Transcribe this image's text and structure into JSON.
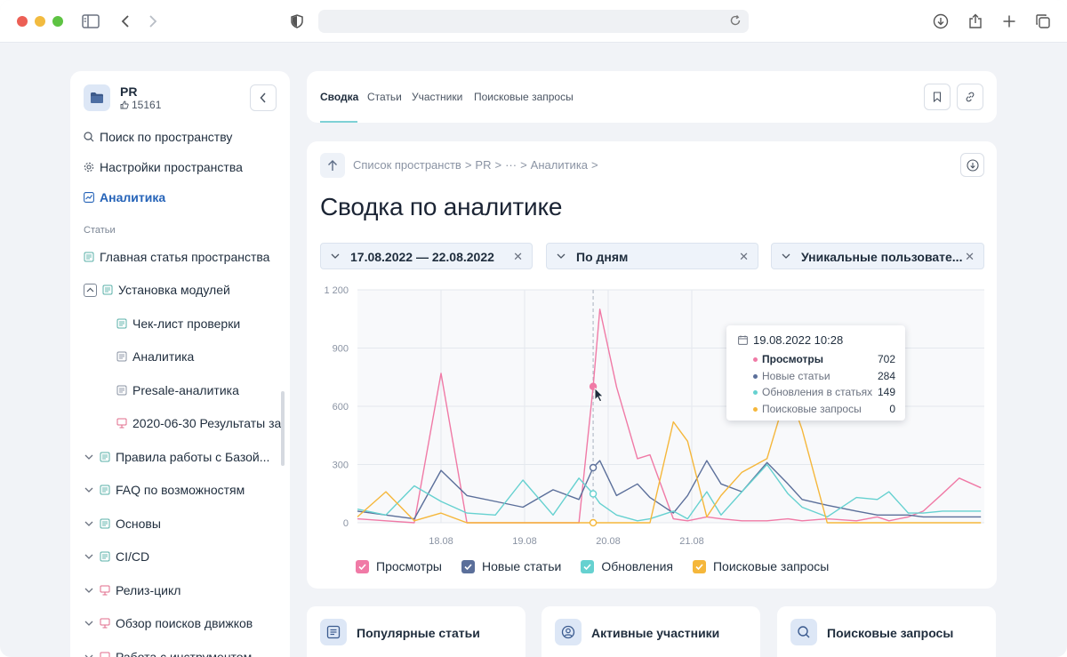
{
  "sidebar": {
    "space_name": "PR",
    "space_likes": "15161",
    "links": [
      {
        "label": "Поиск по пространству"
      },
      {
        "label": "Настройки пространства"
      },
      {
        "label": "Аналитика"
      }
    ],
    "section_label": "Статьи",
    "tree": [
      {
        "label": "Главная статья пространства"
      },
      {
        "label": "Установка модулей"
      },
      {
        "label": "Чек-лист проверки"
      },
      {
        "label": "Аналитика"
      },
      {
        "label": "Presale-аналитика"
      },
      {
        "label": "2020-06-30 Результаты за"
      },
      {
        "label": "Правила работы с Базой..."
      },
      {
        "label": "FAQ по возможностям"
      },
      {
        "label": "Основы"
      },
      {
        "label": "CI/CD"
      },
      {
        "label": "Релиз-цикл"
      },
      {
        "label": "Обзор поисков движков"
      },
      {
        "label": "Работа с инструментом"
      }
    ]
  },
  "tabs": [
    {
      "label": "Сводка"
    },
    {
      "label": "Статьи"
    },
    {
      "label": "Участники"
    },
    {
      "label": "Поисковые запросы"
    }
  ],
  "breadcrumb": {
    "items": [
      "Список пространств",
      "PR",
      "···",
      "Аналитика"
    ],
    "separator": ">"
  },
  "page_title": "Сводка по аналитике",
  "filters": {
    "date_range": "17.08.2022 — 22.08.2022",
    "granularity": "По дням",
    "metric": "Уникальные пользовате..."
  },
  "tooltip": {
    "date": "19.08.2022 10:28",
    "rows": [
      {
        "label": "Просмотры",
        "value": "702",
        "color": "#f07aa6"
      },
      {
        "label": "Новые статьи",
        "value": "284",
        "color": "#5b6f9a"
      },
      {
        "label": "Обновления в статьях",
        "value": "149",
        "color": "#66d1d0"
      },
      {
        "label": "Поисковые запросы",
        "value": "0",
        "color": "#f5b73b"
      }
    ]
  },
  "chart_data": {
    "type": "line",
    "ylim": [
      0,
      1200
    ],
    "y_ticks": [
      "0",
      "300",
      "600",
      "900",
      "1 200"
    ],
    "x_ticks": [
      "18.08",
      "19.08",
      "20.08",
      "21.08"
    ],
    "x_tick_positions": [
      1,
      2,
      3,
      4
    ],
    "x": [
      0,
      0.34,
      0.68,
      1.0,
      1.31,
      1.65,
      1.98,
      2.34,
      2.65,
      2.82,
      2.9,
      3.1,
      3.35,
      3.5,
      3.78,
      3.95,
      4.18,
      4.35,
      4.6,
      4.9,
      5.15,
      5.32,
      5.62,
      5.97,
      6.22,
      6.36,
      6.59,
      6.77,
      7.0,
      7.2,
      7.46
    ],
    "series": [
      {
        "name": "Просмотры",
        "color": "#f07aa6",
        "values": [
          20,
          10,
          0,
          770,
          0,
          0,
          0,
          0,
          0,
          702,
          1100,
          700,
          330,
          350,
          20,
          10,
          30,
          20,
          10,
          10,
          20,
          10,
          20,
          10,
          30,
          10,
          30,
          60,
          150,
          230,
          180
        ]
      },
      {
        "name": "Новые статьи",
        "color": "#5b6f9a",
        "values": [
          60,
          40,
          20,
          270,
          140,
          110,
          80,
          170,
          120,
          284,
          320,
          140,
          200,
          130,
          50,
          140,
          320,
          200,
          160,
          310,
          200,
          120,
          90,
          60,
          40,
          40,
          40,
          30,
          30,
          30,
          30
        ]
      },
      {
        "name": "Обновления",
        "color": "#66d1d0",
        "values": [
          70,
          40,
          190,
          110,
          50,
          40,
          220,
          40,
          230,
          149,
          100,
          40,
          10,
          20,
          60,
          20,
          160,
          40,
          160,
          300,
          150,
          80,
          30,
          130,
          120,
          160,
          50,
          50,
          60,
          60,
          60
        ]
      },
      {
        "name": "Поисковые запросы",
        "color": "#f5b73b",
        "values": [
          30,
          160,
          10,
          50,
          0,
          0,
          0,
          0,
          0,
          0,
          0,
          0,
          0,
          0,
          520,
          420,
          30,
          140,
          260,
          330,
          690,
          480,
          0,
          0,
          0,
          0,
          0,
          0,
          0,
          0,
          0
        ]
      }
    ],
    "legend": [
      {
        "label": "Просмотры",
        "color": "#f07aa6"
      },
      {
        "label": "Новые статьи",
        "color": "#5b6f9a"
      },
      {
        "label": "Обновления",
        "color": "#66d1d0"
      },
      {
        "label": "Поисковые запросы",
        "color": "#f5b73b"
      }
    ],
    "grid": true
  },
  "cards": [
    {
      "title": "Популярные статьи"
    },
    {
      "title": "Активные участники"
    },
    {
      "title": "Поисковые запросы"
    }
  ]
}
